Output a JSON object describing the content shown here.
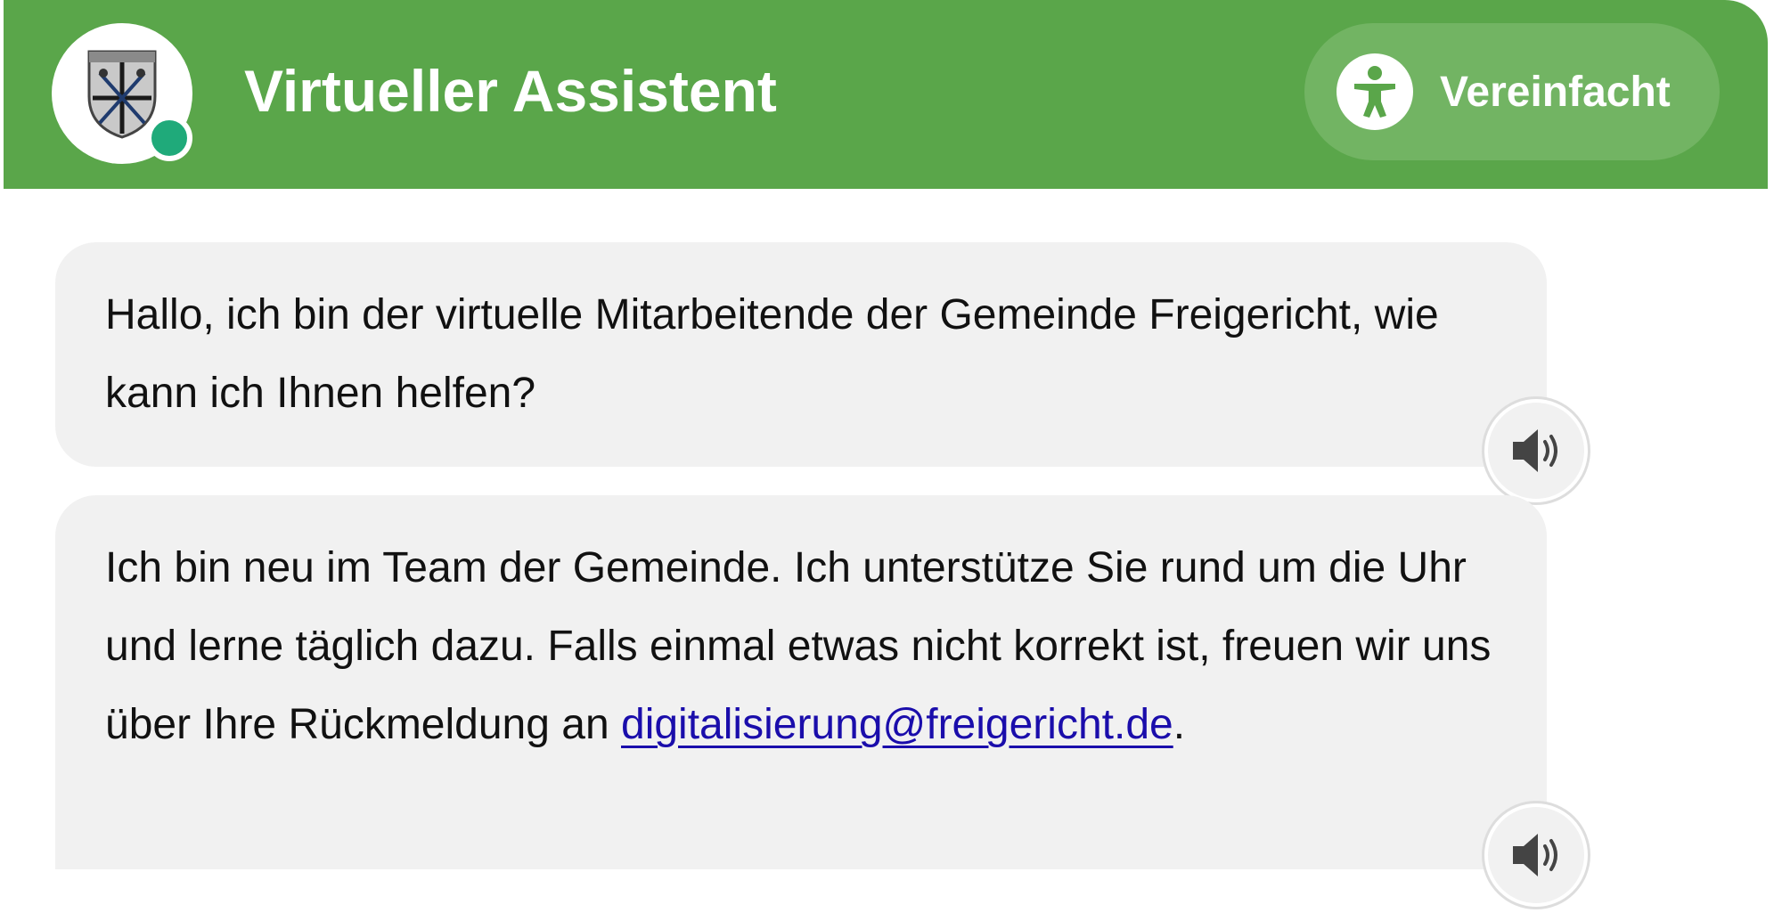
{
  "header": {
    "title": "Virtueller Assistent",
    "simplify_label": "Vereinfacht",
    "avatar_icon": "municipal-coat-of-arms-icon",
    "status_icon": "online-status-icon",
    "simplify_icon": "accessibility-person-icon"
  },
  "messages": [
    {
      "text": "Hallo, ich bin der virtuelle Mitarbeitende der Gemeinde Freigericht, wie kann ich Ihnen helfen?",
      "audio_icon": "speaker-icon"
    },
    {
      "text": "Ich bin neu im Team der Gemeinde. Ich unterstütze Sie rund um die Uhr und lerne täglich dazu. Falls einmal etwas nicht korrekt ist, freuen wir uns über Ihre Rückmeldung an ",
      "link_text": "digitalisierung@freigericht.de",
      "suffix": ".",
      "audio_icon": "speaker-icon"
    }
  ],
  "colors": {
    "header_bg": "#5aa64a",
    "header_button_bg": "#72b463",
    "bubble_bg": "#f1f1f1",
    "status_dot": "#1faa7a",
    "link": "#1a0dab"
  }
}
